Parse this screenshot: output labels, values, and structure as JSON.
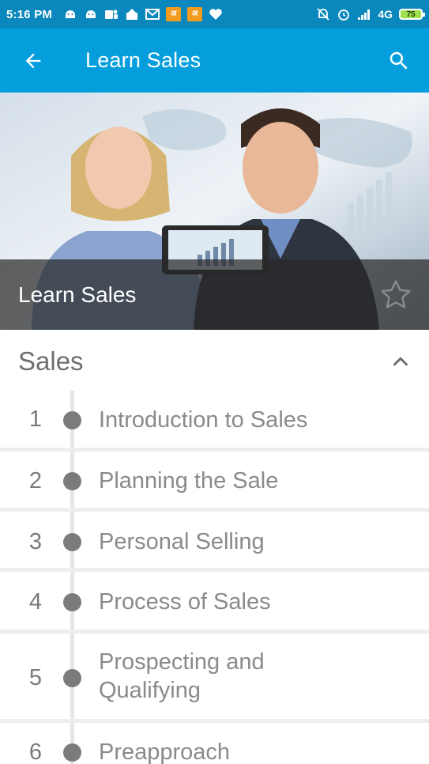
{
  "status_bar": {
    "time": "5:16 PM",
    "network": "4G",
    "battery": "75",
    "left_icons": [
      "android-icon",
      "android-icon",
      "teams-icon",
      "app-icon",
      "gmail-icon",
      "hindi-app-icon",
      "hindi-app-icon",
      "heart-icon"
    ],
    "app_icon_glyph": "अ"
  },
  "app_bar": {
    "title": "Learn Sales"
  },
  "hero": {
    "title": "Learn Sales"
  },
  "section": {
    "title": "Sales"
  },
  "lessons": [
    {
      "number": "1",
      "title": "Introduction to Sales"
    },
    {
      "number": "2",
      "title": "Planning the Sale"
    },
    {
      "number": "3",
      "title": "Personal Selling"
    },
    {
      "number": "4",
      "title": "Process of Sales"
    },
    {
      "number": "5",
      "title": "Prospecting and Qualifying"
    },
    {
      "number": "6",
      "title": "Preapproach"
    }
  ],
  "colors": {
    "status_bar": "#0a88bd",
    "app_bar": "#049edc",
    "dot": "#7b7b7b",
    "text_gray": "#8a8a8a"
  }
}
